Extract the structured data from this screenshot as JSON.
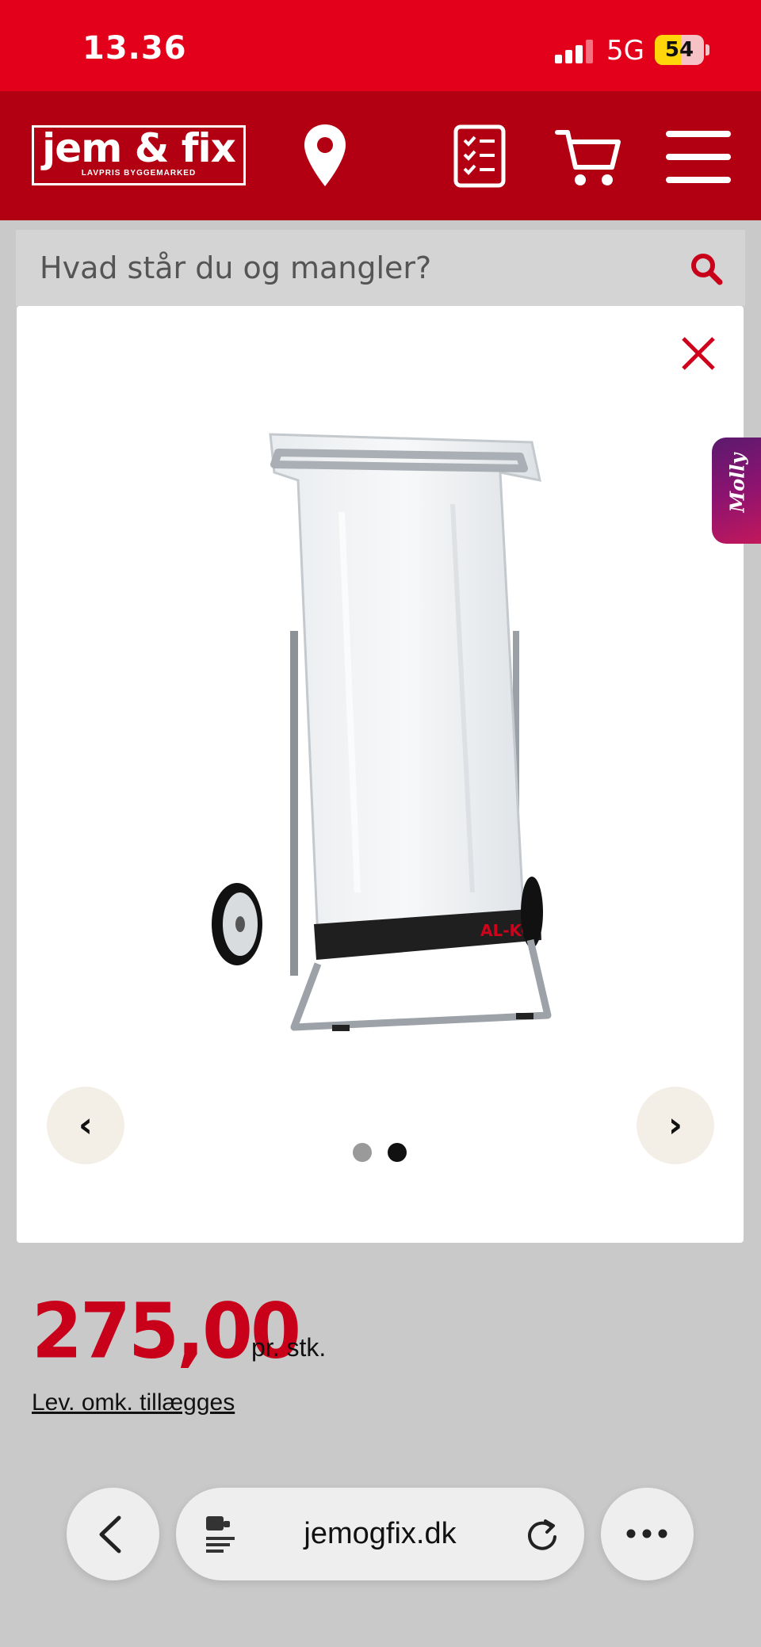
{
  "status_bar": {
    "time": "13.36",
    "network": "5G",
    "battery": "54",
    "battery_level": 0.54
  },
  "header": {
    "logo_main": "jem & fix",
    "logo_sub": "LAVPRIS BYGGEMARKED"
  },
  "search": {
    "placeholder": "Hvad står du og mangler?"
  },
  "gallery": {
    "total_images": 2,
    "active_index": 2,
    "prev_label": "‹",
    "next_label": "›",
    "brand_on_product": "AL-KO"
  },
  "chat_widget": {
    "label": "Molly"
  },
  "product": {
    "price": "275,00",
    "unit": "pr. stk.",
    "delivery_note": "Lev. omk. tillægges"
  },
  "browser": {
    "url": "jemogfix.dk"
  },
  "colors": {
    "brand_red": "#e2001a",
    "header_red": "#b20012",
    "price_red": "#c8001a"
  }
}
